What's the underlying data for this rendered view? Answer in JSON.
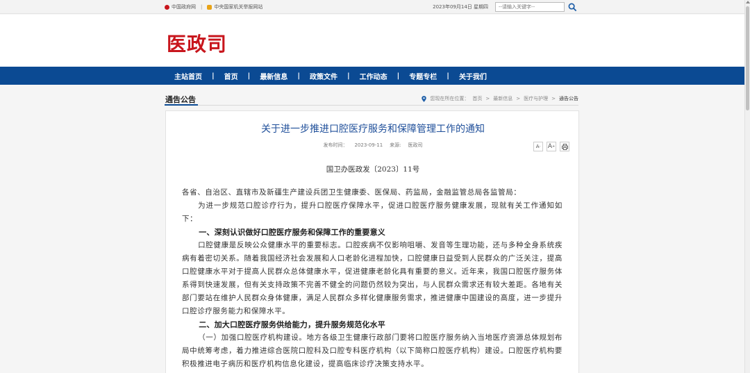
{
  "topbar": {
    "gov_link": "中国政府网",
    "report_link": "中央国家机关举报网站",
    "date": "2023年09月14日 星期四",
    "search_placeholder": "--请输入关键字--"
  },
  "header": {
    "logo": "医政司"
  },
  "nav": {
    "items": [
      "主站首页",
      "首页",
      "最新信息",
      "政策文件",
      "工作动态",
      "专题专栏",
      "关于我们"
    ],
    "divider": "|"
  },
  "section": {
    "title": "通告公告",
    "crumb_prefix": "您现在所在位置：",
    "crumbs": [
      "首页",
      "最新信息",
      "医疗与护理",
      "通告公告"
    ],
    "crumb_sep": ">"
  },
  "article": {
    "title": "关于进一步推进口腔医疗服务和保障管理工作的通知",
    "publish_label": "发布时间：",
    "publish_date": "2023-09-11",
    "source_label": "来源:",
    "source": "医政司",
    "font_small": "A",
    "font_large": "A",
    "doc_no": "国卫办医政发〔2023〕11号",
    "paragraphs": [
      "各省、自治区、直辖市及新疆生产建设兵团卫生健康委、医保局、药监局，金融监管总局各监管局：",
      "为进一步规范口腔诊疗行为，提升口腔医疗保障水平，促进口腔医疗服务健康发展，现就有关工作通知如下：",
      "一、深刻认识做好口腔医疗服务和保障工作的重要意义",
      "口腔健康是反映公众健康水平的重要标志。口腔疾病不仅影响咀嚼、发音等生理功能，还与多种全身系统疾病有着密切关系。随着我国经济社会发展和人口老龄化进程加快，口腔健康日益受到人民群众的广泛关注，提高口腔健康水平对于提高人民群众总体健康水平，促进健康老龄化具有重要的意义。近年来，我国口腔医疗服务体系得到快速发展，但有关支持政策不完善不健全的问题仍然较为突出，与人民群众需求还有较大差距。各地有关部门要站在维护人民群众身体健康，满足人民群众多样化健康服务需求，推进健康中国建设的高度，进一步提升口腔诊疗服务能力和保障水平。",
      "二、加大口腔医疗服务供给能力，提升服务规范化水平",
      "（一）加强口腔医疗机构建设。地方各级卫生健康行政部门要将口腔医疗服务纳入当地医疗资源总体规划布局中统筹考虑，着力推进综合医院口腔科及口腔专科医疗机构（以下简称口腔医疗机构）建设。口腔医疗机构要积极推进电子病历和医疗机构信息化建设，提高临床诊疗决策支持水平。"
    ]
  }
}
